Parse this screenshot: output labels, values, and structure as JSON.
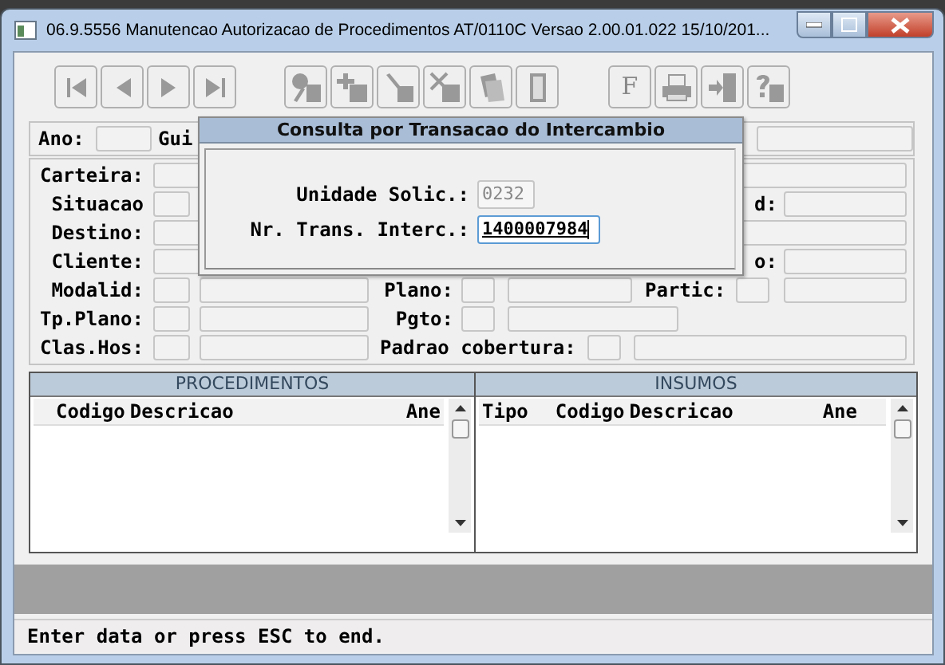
{
  "window": {
    "title": "06.9.5556 Manutencao Autorizacao de Procedimentos AT/0110C Versao 2.00.01.022 15/10/201..."
  },
  "toolbar": [
    {
      "kind": "first"
    },
    {
      "kind": "prev"
    },
    {
      "kind": "next"
    },
    {
      "kind": "last"
    },
    {
      "kind": "key"
    },
    {
      "kind": "add"
    },
    {
      "kind": "edit"
    },
    {
      "kind": "delete"
    },
    {
      "kind": "copy"
    },
    {
      "kind": "door"
    },
    {
      "kind": "letter",
      "glyph": "F"
    },
    {
      "kind": "print"
    },
    {
      "kind": "exit"
    },
    {
      "kind": "help"
    }
  ],
  "form": {
    "ano": "Ano:",
    "guia": "Gui",
    "carteira": "Carteira:",
    "situacao": "Situacao",
    "situacao_right": "d:",
    "destino": "Destino:",
    "cliente": "Cliente:",
    "cliente_right": "o:",
    "modalid": "Modalid:",
    "plano": "Plano:",
    "partic": "Partic:",
    "tp_plano": "Tp.Plano:",
    "pgto": "Pgto:",
    "clas_hos": "Clas.Hos:",
    "padrao_cobertura": "Padrao cobertura:"
  },
  "dialog": {
    "title": "Consulta por Transacao do Intercambio",
    "fields": [
      {
        "label": "Unidade Solic.:",
        "value": "0232",
        "disabled": true,
        "focused": false
      },
      {
        "label": "Nr. Trans. Interc.:",
        "value": "1400007984",
        "disabled": false,
        "focused": true
      }
    ]
  },
  "grids": [
    {
      "title": "PROCEDIMENTOS",
      "columns": [
        "Codigo",
        "Descricao",
        "Ane"
      ]
    },
    {
      "title": "INSUMOS",
      "columns": [
        "Tipo",
        "Codigo",
        "Descricao",
        "Ane"
      ]
    }
  ],
  "status_bar": "Enter data or press ESC to end."
}
